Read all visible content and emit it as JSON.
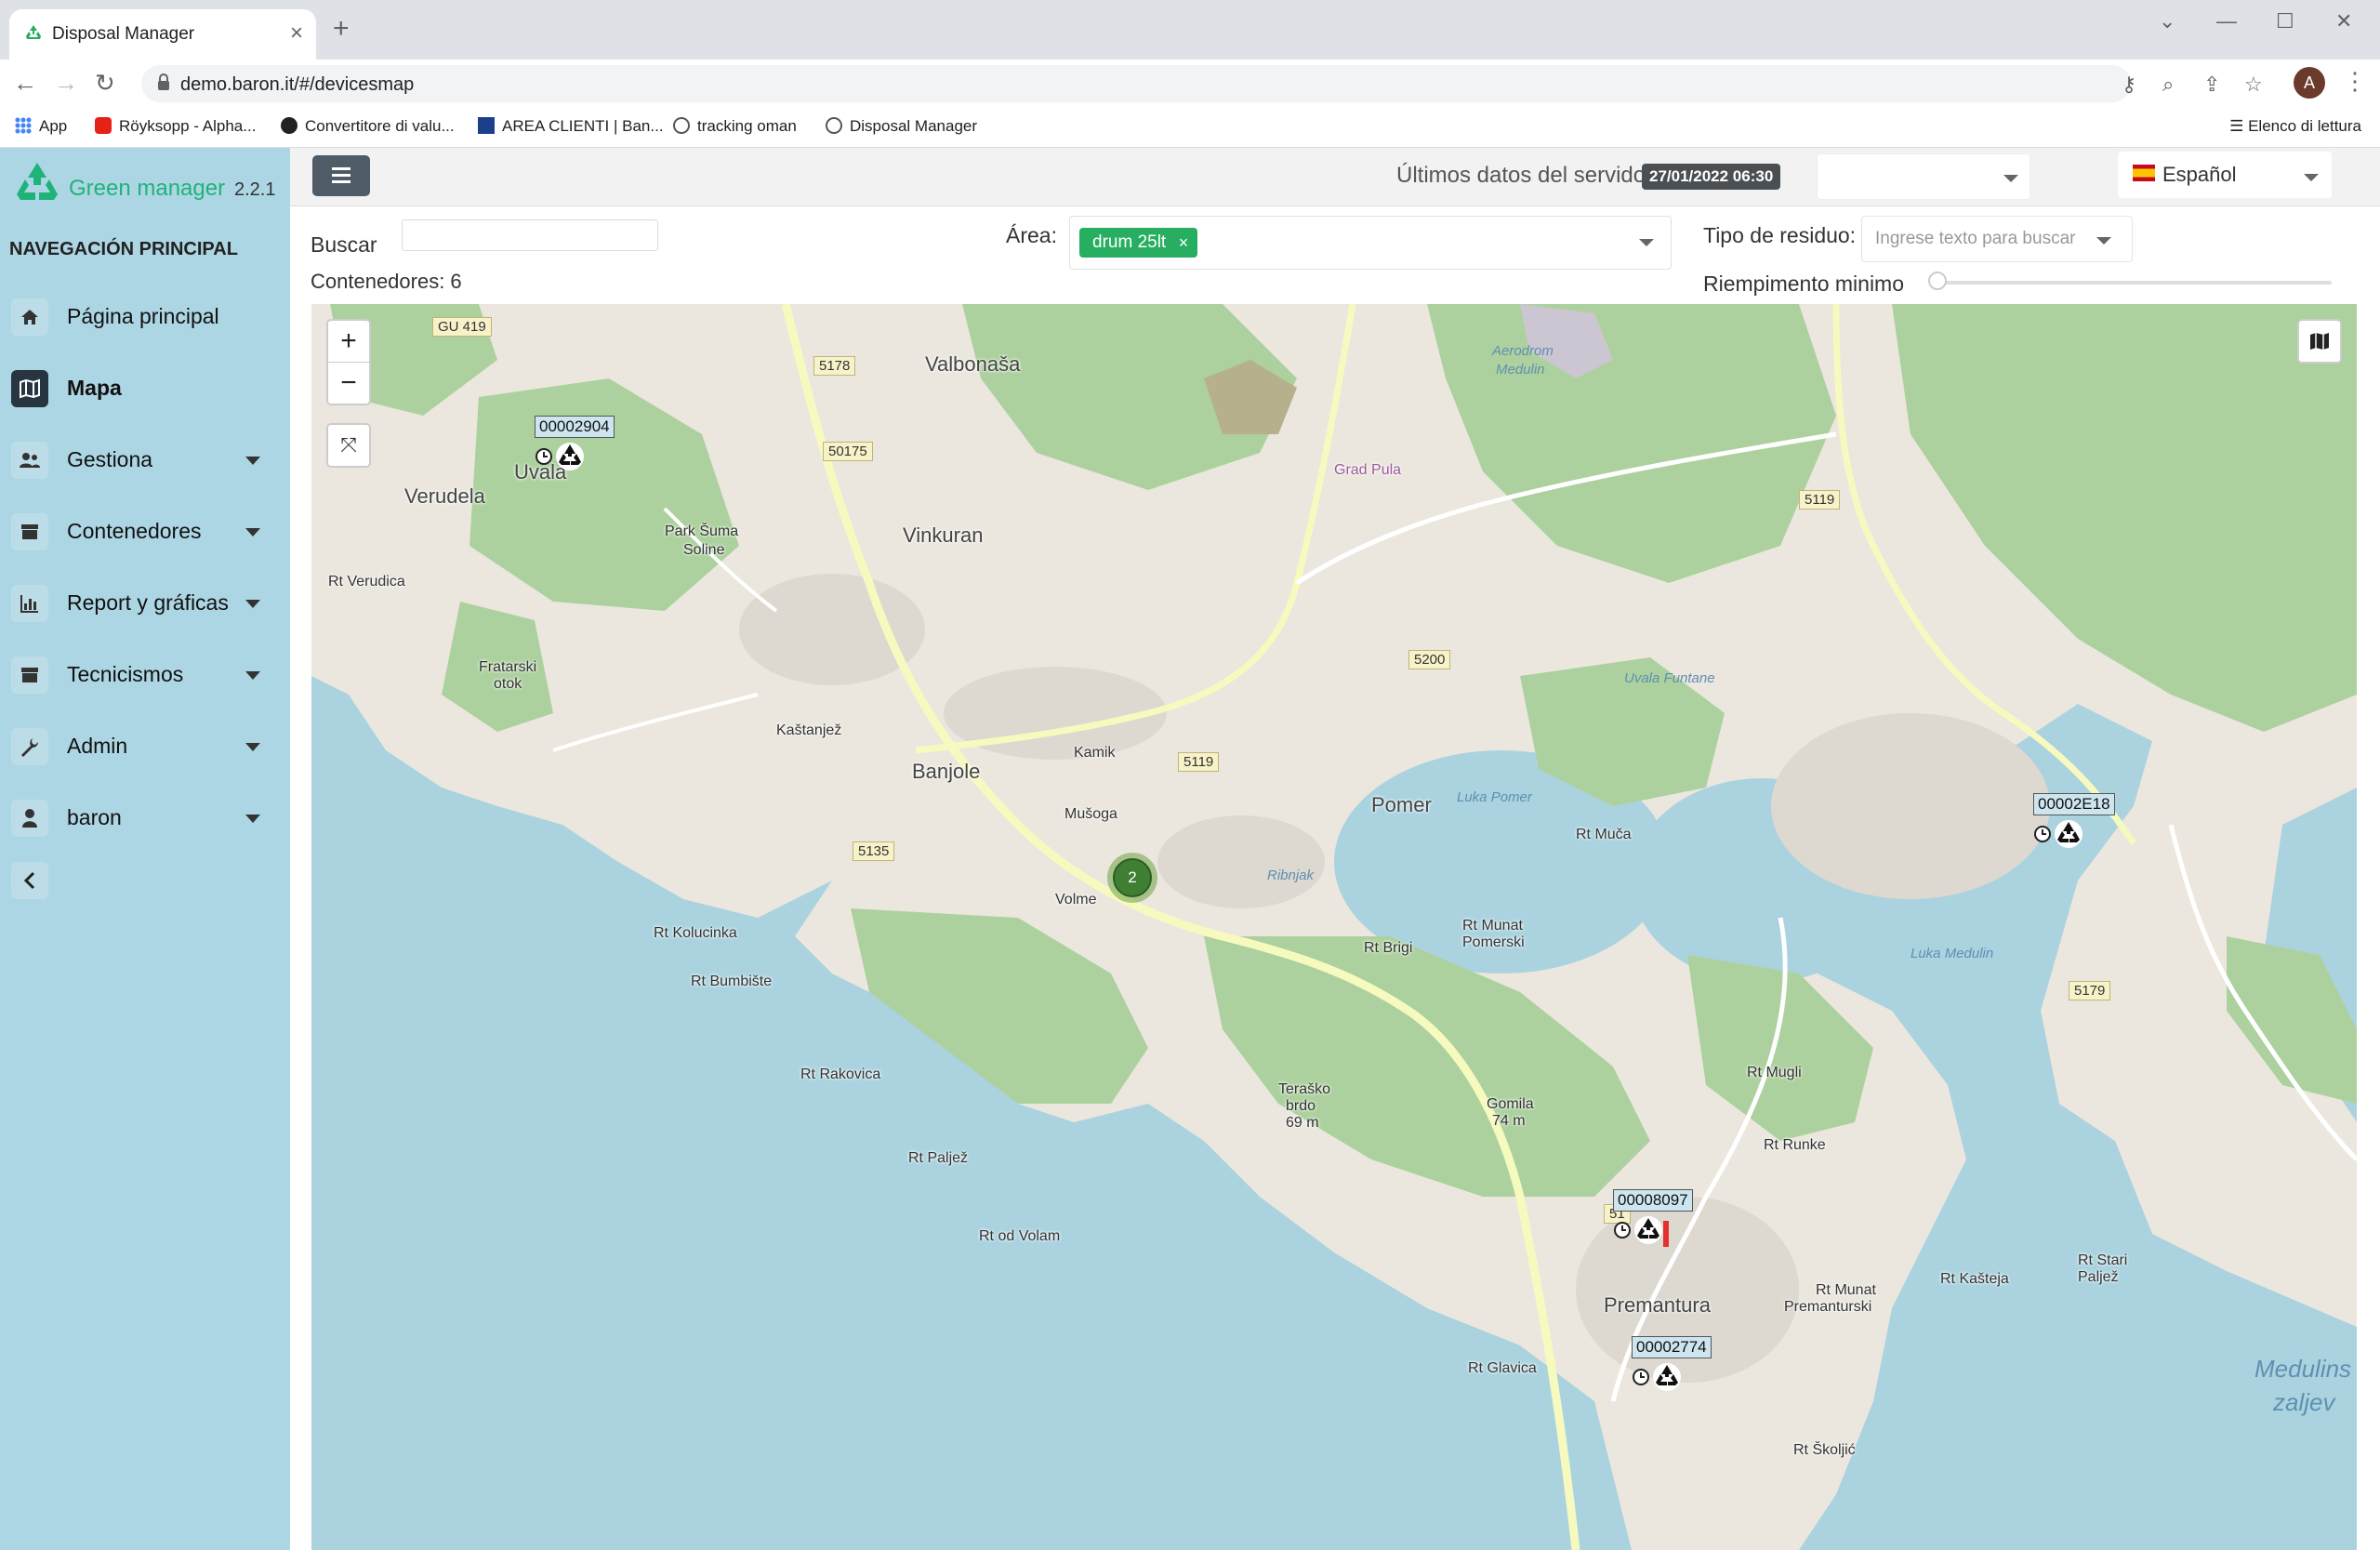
{
  "browser": {
    "tab_title": "Disposal Manager",
    "url": "demo.baron.it/#/devicesmap",
    "profile_initial": "A",
    "bookmarks": [
      "App",
      "Röyksopp - Alpha...",
      "Convertitore di valu...",
      "AREA CLIENTI | Ban...",
      "tracking oman",
      "Disposal Manager"
    ],
    "reading_list": "Elenco di lettura"
  },
  "sidebar": {
    "brand_name": "Green manager",
    "version": "2.2.1",
    "heading": "NAVEGACIÓN PRINCIPAL",
    "items": [
      {
        "label": "Página principal",
        "icon": "home-icon",
        "active": false
      },
      {
        "label": "Mapa",
        "icon": "map-icon",
        "active": true
      },
      {
        "label": "Gestiona",
        "icon": "users-icon",
        "active": false
      },
      {
        "label": "Contenedores",
        "icon": "archive-icon",
        "active": false
      },
      {
        "label": "Report y gráficas",
        "icon": "bar-chart-icon",
        "active": false
      },
      {
        "label": "Tecnicismos",
        "icon": "archive-icon",
        "active": false
      },
      {
        "label": "Admin",
        "icon": "wrench-icon",
        "active": false
      },
      {
        "label": "baron",
        "icon": "user-icon",
        "active": false
      }
    ]
  },
  "header": {
    "server_label": "Últimos datos del servidor:",
    "server_date": "27/01/2022 06:30",
    "language": "Español"
  },
  "filters": {
    "search_label": "Buscar",
    "search_value": "",
    "count_label": "Contenedores: 6",
    "area_label": "Área:",
    "area_chip": "drum 25lt",
    "area_chip_remove": "×",
    "waste_label": "Tipo de residuo:",
    "waste_placeholder": "Ingrese texto para buscar",
    "fill_label": "Riempimento minimo",
    "fill_value": 0
  },
  "map": {
    "zoom_in": "+",
    "zoom_out": "−",
    "fullscreen": "⤧",
    "cluster_count": "2",
    "markers": [
      {
        "id": "00002904",
        "fill_percent": 0
      },
      {
        "id": "00002E18",
        "fill_percent": 0
      },
      {
        "id": "00008097",
        "fill_percent": 80
      },
      {
        "id": "00002774",
        "fill_percent": 0
      }
    ],
    "places": {
      "verudela": "Verudela",
      "rt_verudica": "Rt Verudica",
      "punta_uvala": "Uvala",
      "vinkuran": "Vinkuran",
      "park": "Park Šuma",
      "park2": "Soline",
      "valbonasa": "Valbonaša",
      "aerodrom": "Aerodrom",
      "aerodrom2": "Medulin",
      "banjole": "Banjole",
      "kastanjez": "Kaštanjež",
      "kamik": "Kamik",
      "musoga": "Mušoga",
      "volme": "Volme",
      "pomer": "Pomer",
      "rt_muca": "Rt Muča",
      "rt_brigi": "Rt Brigi",
      "rt_munat_pomerski": "Rt Munat",
      "rt_munat_pomerski2": "Pomerski",
      "frataroski": "Fratarski",
      "frataroski2": "otok",
      "rt_kolucinka": "Rt Kolucinka",
      "rt_bumbiste": "Rt Bumbište",
      "rt_rakovica": "Rt Rakovica",
      "rt_paljez": "Rt Paljež",
      "rt_od_volam": "Rt od Volam",
      "terasko": "Teraško",
      "terasko2": "brdo",
      "terasko3": "69 m",
      "gomila": "Gomila",
      "gomila2": "74 m",
      "rt_mugli": "Rt Mugli",
      "rt_runke": "Rt Runke",
      "premantura": "Premantura",
      "rt_munat_premanturski": "Rt Munat",
      "rt_munat_premanturski2": "Premanturski",
      "rt_glavica": "Rt Glavica",
      "rt_skoljic": "Rt Školjić",
      "rt_kasteja": "Rt Kašteja",
      "rt_stari": "Rt Stari",
      "rt_stari2": "Paljež",
      "medulin_bay": "Medulins",
      "medulin_bay2": "zaljev",
      "luka_medulin": "Luka Medulin",
      "luka_pomer": "Luka Pomer",
      "uvala_funtane": "Uvala Funtane",
      "ribnjak": "Ribnjak",
      "grad_pula": "Grad Pula"
    },
    "roads": [
      "GU 419",
      "5178",
      "50175",
      "5119",
      "5200",
      "5119",
      "5135",
      "5179",
      "51"
    ]
  },
  "colors": {
    "sidebar_bg": "#add6e4",
    "brand_green": "#1fb37a",
    "chip_green": "#27ae60",
    "water": "#aad3df",
    "forest": "#add19e",
    "land": "#ebe7de"
  }
}
